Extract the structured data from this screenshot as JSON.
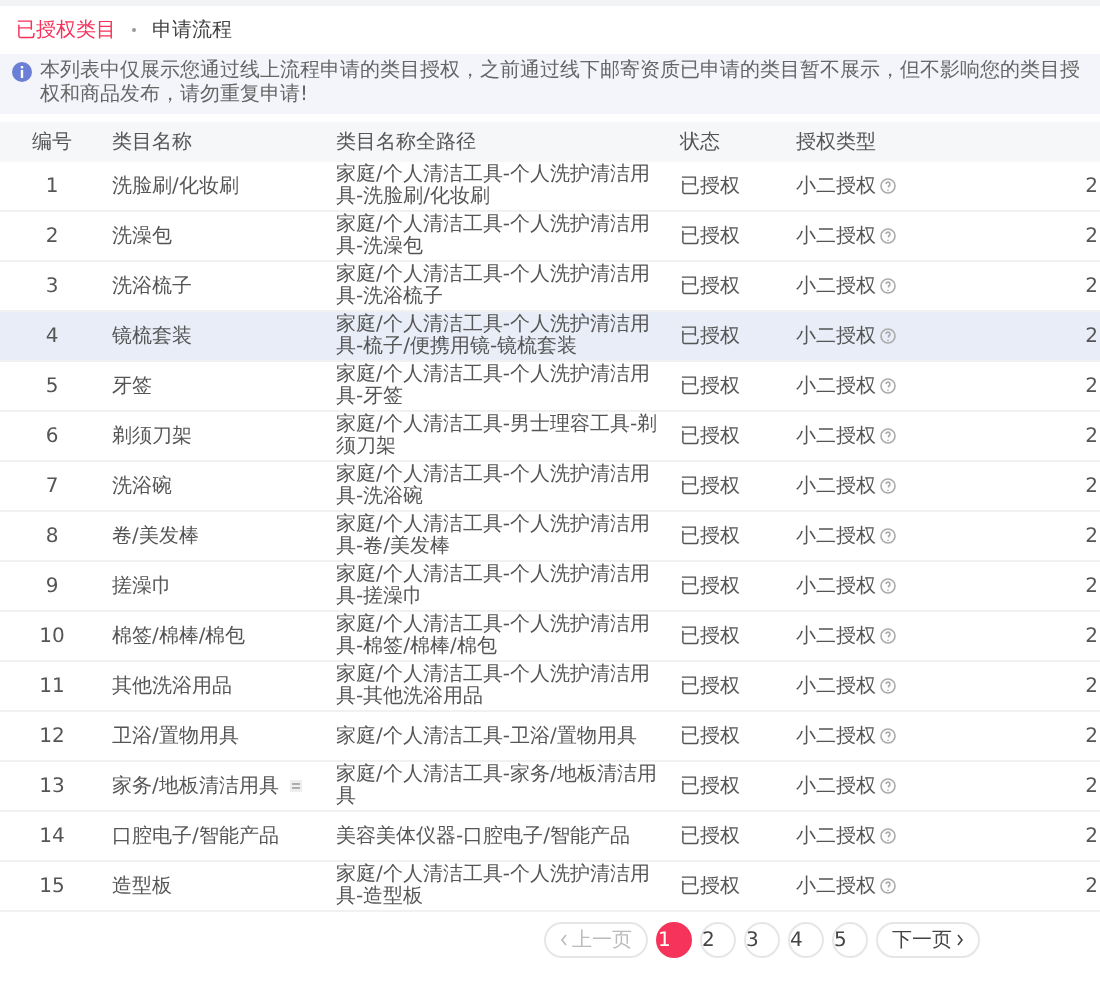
{
  "tabs": [
    {
      "label": "已授权类目",
      "selected": true
    },
    {
      "label": "申请流程",
      "selected": false
    }
  ],
  "notice": "本列表中仅展示您通过线上流程申请的类目授权，之前通过线下邮寄资质已申请的类目暂不展示，但不影响您的类目授权和商品发布，请勿重复申请!",
  "table": {
    "columns": [
      "编号",
      "类目名称",
      "类目名称全路径",
      "状态",
      "授权类型"
    ],
    "rows": [
      {
        "number": "1",
        "name": "洗脸刷/化妆刷",
        "path": "家庭/个人清洁工具-个人洗护清洁用具-洗脸刷/化妆刷",
        "status": "已授权",
        "auth_type": "小二授权",
        "column_6": "2",
        "highlighted": false
      },
      {
        "number": "2",
        "name": "洗澡包",
        "path": "家庭/个人清洁工具-个人洗护清洁用具-洗澡包",
        "status": "已授权",
        "auth_type": "小二授权",
        "column_6": "2",
        "highlighted": false
      },
      {
        "number": "3",
        "name": "洗浴梳子",
        "path": "家庭/个人清洁工具-个人洗护清洁用具-洗浴梳子",
        "status": "已授权",
        "auth_type": "小二授权",
        "column_6": "2",
        "highlighted": false
      },
      {
        "number": "4",
        "name": "镜梳套装",
        "path": "家庭/个人清洁工具-个人洗护清洁用具-梳子/便携用镜-镜梳套装",
        "status": "已授权",
        "auth_type": "小二授权",
        "column_6": "2",
        "highlighted": true
      },
      {
        "number": "5",
        "name": "牙签",
        "path": "家庭/个人清洁工具-个人洗护清洁用具-牙签",
        "status": "已授权",
        "auth_type": "小二授权",
        "column_6": "2",
        "highlighted": false
      },
      {
        "number": "6",
        "name": "剃须刀架",
        "path": "家庭/个人清洁工具-男士理容工具-剃须刀架",
        "status": "已授权",
        "auth_type": "小二授权",
        "column_6": "2",
        "highlighted": false
      },
      {
        "number": "7",
        "name": "洗浴碗",
        "path": "家庭/个人清洁工具-个人洗护清洁用具-洗浴碗",
        "status": "已授权",
        "auth_type": "小二授权",
        "column_6": "2",
        "highlighted": false
      },
      {
        "number": "8",
        "name": "卷/美发棒",
        "path": "家庭/个人清洁工具-个人洗护清洁用具-卷/美发棒",
        "status": "已授权",
        "auth_type": "小二授权",
        "column_6": "2",
        "highlighted": false
      },
      {
        "number": "9",
        "name": "搓澡巾",
        "path": "家庭/个人清洁工具-个人洗护清洁用具-搓澡巾",
        "status": "已授权",
        "auth_type": "小二授权",
        "column_6": "2",
        "highlighted": false
      },
      {
        "number": "10",
        "name": "棉签/棉棒/棉包",
        "path": "家庭/个人清洁工具-个人洗护清洁用具-棉签/棉棒/棉包",
        "status": "已授权",
        "auth_type": "小二授权",
        "column_6": "2",
        "highlighted": false
      },
      {
        "number": "11",
        "name": "其他洗浴用品",
        "path": "家庭/个人清洁工具-个人洗护清洁用具-其他洗浴用品",
        "status": "已授权",
        "auth_type": "小二授权",
        "column_6": "2",
        "highlighted": false
      },
      {
        "number": "12",
        "name": "卫浴/置物用具",
        "path": "家庭/个人清洁工具-卫浴/置物用具",
        "status": "已授权",
        "auth_type": "小二授权",
        "column_6": "2",
        "highlighted": false
      },
      {
        "number": "13",
        "name": "家务/地板清洁用具",
        "path": "家庭/个人清洁工具-家务/地板清洁用具",
        "status": "已授权",
        "auth_type": "小二授权",
        "column_6": "2",
        "highlighted": false,
        "icon": true
      },
      {
        "number": "14",
        "name": "口腔电子/智能产品",
        "path": "美容美体仪器-口腔电子/智能产品",
        "status": "已授权",
        "auth_type": "小二授权",
        "column_6": "2",
        "highlighted": false
      },
      {
        "number": "15",
        "name": "造型板",
        "path": "家庭/个人清洁工具-个人洗护清洁用具-造型板",
        "status": "已授权",
        "auth_type": "小二授权",
        "column_6": "2",
        "highlighted": false
      }
    ]
  },
  "pagination": {
    "prev": {
      "label": "上一页",
      "disabled": true
    },
    "pages": [
      {
        "label": "1",
        "selected": true
      },
      {
        "label": "2",
        "selected": false
      },
      {
        "label": "3",
        "selected": false
      },
      {
        "label": "4",
        "selected": false
      },
      {
        "label": "5",
        "selected": false
      }
    ],
    "next": {
      "label": "下一页",
      "disabled": false
    }
  }
}
